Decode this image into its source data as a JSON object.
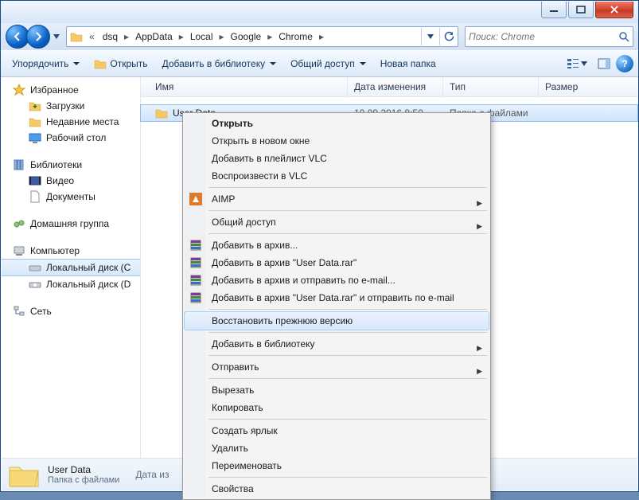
{
  "titlebar": {},
  "nav": {},
  "breadcrumb": {
    "prefix": "«",
    "items": [
      "dsq",
      "AppData",
      "Local",
      "Google",
      "Chrome"
    ]
  },
  "search": {
    "placeholder": "Поиск: Chrome"
  },
  "toolbar": {
    "organize": "Упорядочить",
    "open": "Открыть",
    "add_library": "Добавить в библиотеку",
    "share": "Общий доступ",
    "new_folder": "Новая папка"
  },
  "sidebar": {
    "favorites": {
      "label": "Избранное",
      "items": [
        {
          "label": "Загрузки"
        },
        {
          "label": "Недавние места"
        },
        {
          "label": "Рабочий стол"
        }
      ]
    },
    "libraries": {
      "label": "Библиотеки",
      "items": [
        {
          "label": "Видео"
        },
        {
          "label": "Документы"
        }
      ]
    },
    "homegroup": {
      "label": "Домашняя группа"
    },
    "computer": {
      "label": "Компьютер",
      "items": [
        {
          "label": "Локальный диск (C",
          "selected": true
        },
        {
          "label": "Локальный диск (D"
        }
      ]
    },
    "network": {
      "label": "Сеть"
    }
  },
  "columns": {
    "name": "Имя",
    "date": "Дата изменения",
    "type": "Тип",
    "size": "Размер"
  },
  "rows": [
    {
      "name": "User Data",
      "date": "10.09.2016 8:50",
      "type": "Папка с файлами",
      "size": "",
      "selected": true
    }
  ],
  "details": {
    "title": "User Data",
    "subtitle": "Папка с файлами",
    "meta_label": "Дата из"
  },
  "context_menu": {
    "groups": [
      [
        {
          "label": "Открыть",
          "bold": true
        },
        {
          "label": "Открыть в новом окне"
        },
        {
          "label": "Добавить в плейлист VLC"
        },
        {
          "label": "Воспроизвести в VLC"
        }
      ],
      [
        {
          "label": "AIMP",
          "icon": "aimp",
          "submenu": true
        }
      ],
      [
        {
          "label": "Общий доступ",
          "submenu": true
        }
      ],
      [
        {
          "label": "Добавить в архив...",
          "icon": "rar"
        },
        {
          "label": "Добавить в архив \"User Data.rar\"",
          "icon": "rar"
        },
        {
          "label": "Добавить в архив и отправить по e-mail...",
          "icon": "rar"
        },
        {
          "label": "Добавить в архив \"User Data.rar\" и отправить по e-mail",
          "icon": "rar"
        }
      ],
      [
        {
          "label": "Восстановить прежнюю версию",
          "hover": true
        }
      ],
      [
        {
          "label": "Добавить в библиотеку",
          "submenu": true
        }
      ],
      [
        {
          "label": "Отправить",
          "submenu": true
        }
      ],
      [
        {
          "label": "Вырезать"
        },
        {
          "label": "Копировать"
        }
      ],
      [
        {
          "label": "Создать ярлык"
        },
        {
          "label": "Удалить"
        },
        {
          "label": "Переименовать"
        }
      ],
      [
        {
          "label": "Свойства"
        }
      ]
    ]
  }
}
